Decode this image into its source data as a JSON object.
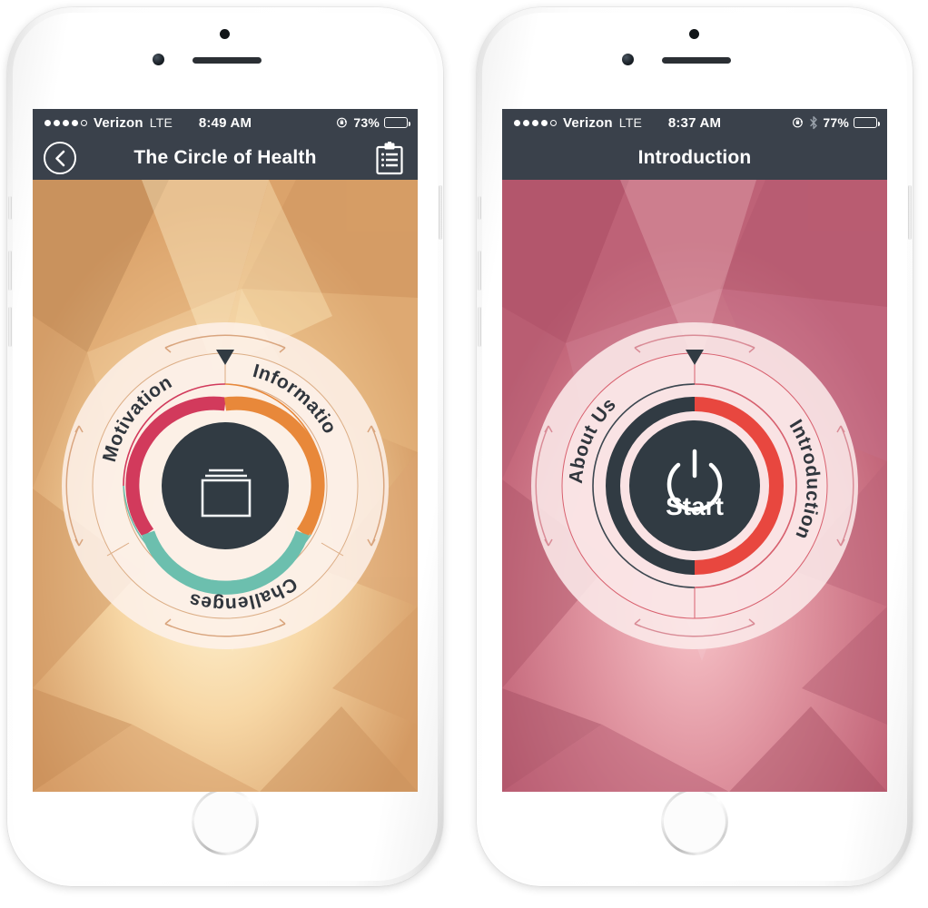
{
  "page": {
    "title": "The Circle of Health app — two iPhone screens",
    "background": "#ffffff"
  },
  "colors": {
    "navbar": "#3a414b",
    "dark_slate": "#313b43",
    "crimson": "#d23a5c",
    "orange": "#e8883a",
    "teal": "#6cbfae",
    "red": "#e8473f",
    "cream": "#fbeee8",
    "amber_bg": "#e9a86a",
    "rose_bg": "#d4697f"
  },
  "phones": [
    {
      "id": "left",
      "status_bar": {
        "signal_dots_filled": 4,
        "signal_dots_total": 5,
        "carrier": "Verizon",
        "network": "LTE",
        "time": "8:49 AM",
        "icons": [
          "rotation-lock-icon"
        ],
        "battery_percent": "73%",
        "battery_level": 73
      },
      "nav_bar": {
        "back_icon": "chevron-left-icon",
        "title": "The Circle of Health",
        "action_icon": "clipboard-list-icon"
      },
      "theme": "amber",
      "wheel": {
        "pointer": "triangle-down-marker",
        "center_icon": "cards-stack-icon",
        "center_label": "",
        "segments": [
          {
            "label": "Motivation",
            "color": "#d23a5c",
            "start_deg": 270,
            "end_deg": 360
          },
          {
            "label": "Information",
            "color": "#e8883a",
            "start_deg": 0,
            "end_deg": 115
          },
          {
            "label": "Challenges",
            "color": "#6cbfae",
            "start_deg": 115,
            "end_deg": 270
          }
        ],
        "rotation_hint_arrows": 4
      }
    },
    {
      "id": "right",
      "status_bar": {
        "signal_dots_filled": 4,
        "signal_dots_total": 5,
        "carrier": "Verizon",
        "network": "LTE",
        "time": "8:37 AM",
        "icons": [
          "rotation-lock-icon",
          "bluetooth-icon"
        ],
        "battery_percent": "77%",
        "battery_level": 77
      },
      "nav_bar": {
        "back_icon": "",
        "title": "Introduction",
        "action_icon": ""
      },
      "theme": "rose",
      "wheel": {
        "pointer": "triangle-down-marker",
        "center_icon": "power-icon",
        "center_label": "Start",
        "segments": [
          {
            "label": "About Us",
            "color": "#313b43",
            "start_deg": 180,
            "end_deg": 360
          },
          {
            "label": "Introduction",
            "color": "#e8473f",
            "start_deg": 0,
            "end_deg": 180
          }
        ],
        "rotation_hint_arrows": 4
      }
    }
  ]
}
